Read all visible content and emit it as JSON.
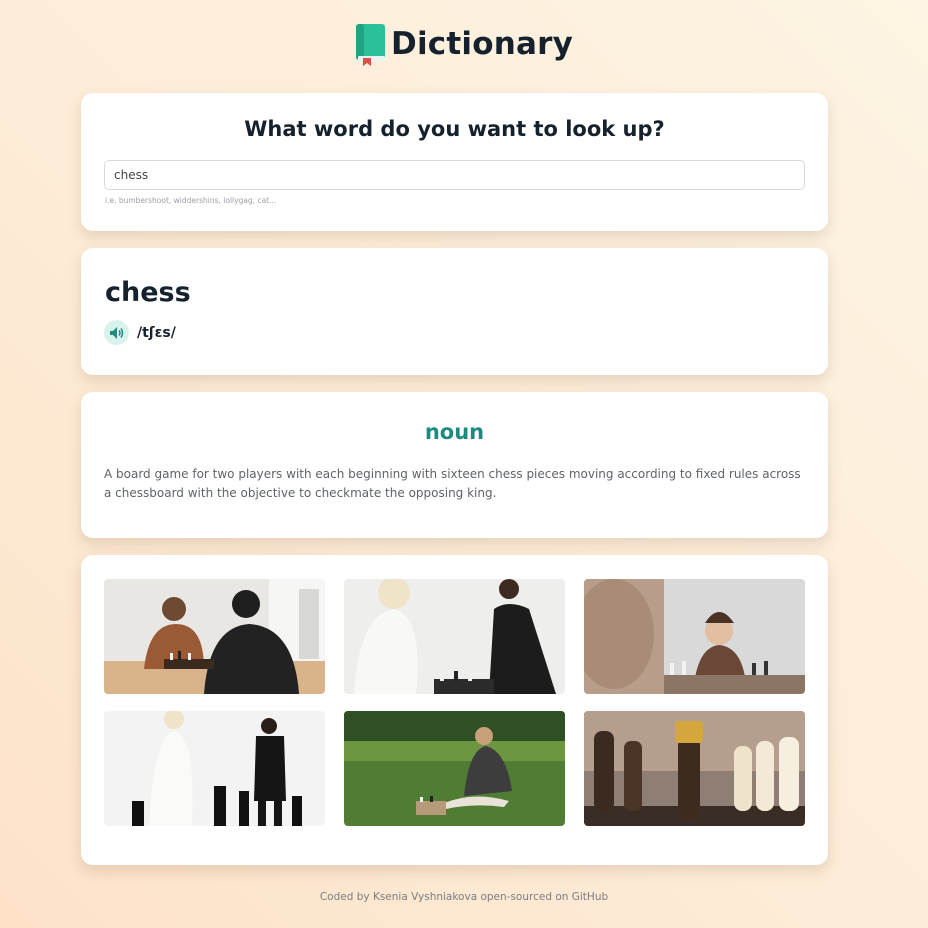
{
  "header": {
    "title": "Dictionary",
    "logo_icon": "book-icon"
  },
  "search": {
    "heading": "What word do you want to look up?",
    "value": "chess",
    "hint": "i.e. bumbershoot, widdershins, lollygag, cat..."
  },
  "word": {
    "term": "chess",
    "phonetic": "/tʃɛs/",
    "audio_icon": "speaker-icon"
  },
  "meanings": [
    {
      "part_of_speech": "noun",
      "definition": "A board game for two players with each beginning with sixteen chess pieces moving according to fixed rules across a chessboard with the objective to checkmate the opposing king."
    }
  ],
  "photos": [
    {
      "subject": "two men playing chess at a table"
    },
    {
      "subject": "woman in white and man in black standing at a chessboard"
    },
    {
      "subject": "boy playing chess"
    },
    {
      "subject": "woman and man with giant chess pieces"
    },
    {
      "subject": "woman playing chess on grass"
    },
    {
      "subject": "chess pieces close-up with king"
    }
  ],
  "footer": {
    "text": "Coded by Ksenia Vyshniakova open-sourced on GitHub"
  },
  "colors": {
    "accent": "#1e8a7f",
    "logo_green": "#2bbf9a",
    "speaker_bg": "#d8f2ee",
    "text_dark": "#16212e"
  }
}
